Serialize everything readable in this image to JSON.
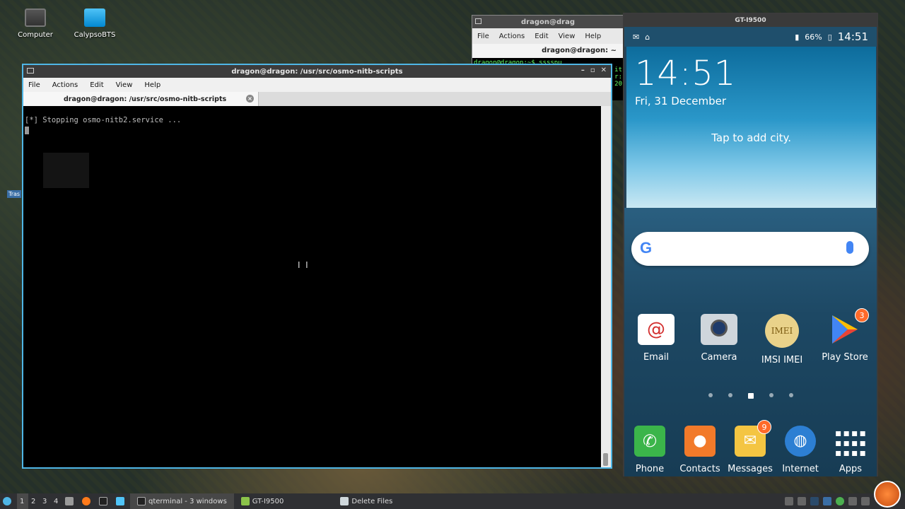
{
  "desktop": {
    "icons": [
      {
        "label": "Computer"
      },
      {
        "label": "CalypsoBTS"
      }
    ],
    "trash_label": "Tras"
  },
  "bg_terminal": {
    "title": "dragon@drag",
    "menu": [
      "File",
      "Actions",
      "Edit",
      "View",
      "Help"
    ],
    "tab_label": "dragon@dragon: ~",
    "lines": [
      "dragon@dragon:~$ sssspu",
      "it",
      "r:",
      "20"
    ]
  },
  "terminal": {
    "title": "dragon@dragon: /usr/src/osmo-nitb-scripts",
    "menu": [
      "File",
      "Actions",
      "Edit",
      "View",
      "Help"
    ],
    "tab_label": "dragon@dragon: /usr/src/osmo-nitb-scripts",
    "output_line": "[*] Stopping osmo-nitb2.service ..."
  },
  "phone": {
    "window_title": "GT-I9500",
    "battery": "66%",
    "status_time": "14:51",
    "clock": "14:51",
    "date": "Fri, 31 December",
    "weather_prompt": "Tap to add city.",
    "search_logo": "G",
    "apps_row1": [
      {
        "label": "Email",
        "icon": "email-icon",
        "color": "#ffffff",
        "badge": ""
      },
      {
        "label": "Camera",
        "icon": "camera-icon",
        "color": "#cfd6dc",
        "badge": ""
      },
      {
        "label": "IMSI IMEI",
        "icon": "imei-icon",
        "color": "#e9d28a",
        "badge": "",
        "text": "IMEI"
      },
      {
        "label": "Play Store",
        "icon": "play-store-icon",
        "color": "#34a853",
        "badge": "3"
      }
    ],
    "apps_dock": [
      {
        "label": "Phone",
        "icon": "phone-icon",
        "color": "#3bb54a",
        "badge": ""
      },
      {
        "label": "Contacts",
        "icon": "contacts-icon",
        "color": "#f27a2a",
        "badge": ""
      },
      {
        "label": "Messages",
        "icon": "messages-icon",
        "color": "#f4c542",
        "badge": "9"
      },
      {
        "label": "Internet",
        "icon": "internet-icon",
        "color": "#2d7fd3",
        "badge": ""
      },
      {
        "label": "Apps",
        "icon": "apps-grid-icon",
        "color": "#ffffff",
        "badge": ""
      }
    ]
  },
  "taskbar": {
    "workspaces": [
      "1",
      "2",
      "3",
      "4"
    ],
    "tasks": [
      {
        "label": "qterminal - 3 windows",
        "active": true
      },
      {
        "label": "GT-I9500",
        "active": false
      },
      {
        "label": "Delete Files",
        "active": false
      }
    ]
  }
}
